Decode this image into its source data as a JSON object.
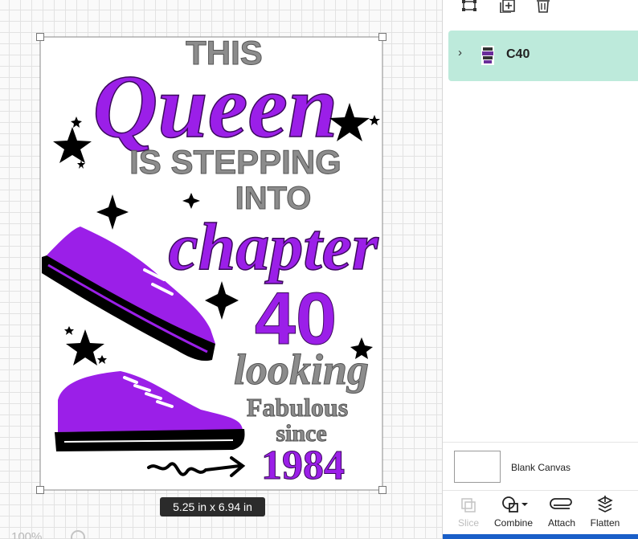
{
  "canvas": {
    "dimension_label": "5.25  in x 6.94  in",
    "zoom_readout": "100%",
    "design_text": {
      "line1": "THIS",
      "line2": "Queen",
      "line3": "IS STEPPING",
      "line4": "INTO",
      "line5": "chapter",
      "line6": "40",
      "line7": "looking",
      "line8": "Fabulous",
      "line9": "since",
      "line10": "1984"
    },
    "colors": {
      "purple": "#9b1fe8",
      "gray": "#8c8c8c",
      "black": "#000000",
      "selection": "#888888"
    }
  },
  "panel": {
    "top_icons": [
      "group-icon",
      "duplicate-icon",
      "delete-icon"
    ],
    "layer": {
      "name": "C40",
      "icon": "layer-thumbnail-icon"
    },
    "blank_canvas": {
      "label": "Blank Canvas"
    },
    "toolbar": [
      {
        "label": "Slice",
        "icon": "slice-icon",
        "enabled": false
      },
      {
        "label": "Combine",
        "icon": "combine-icon",
        "enabled": true
      },
      {
        "label": "Attach",
        "icon": "attach-icon",
        "enabled": true
      },
      {
        "label": "Flatten",
        "icon": "flatten-icon",
        "enabled": true
      }
    ],
    "accent": "#bdeadb"
  }
}
